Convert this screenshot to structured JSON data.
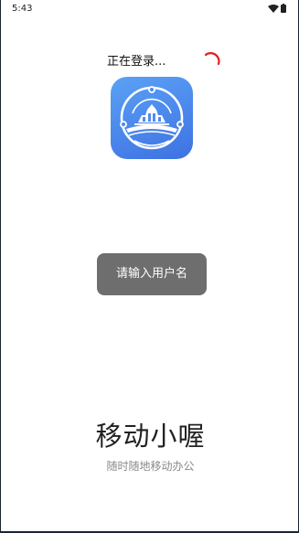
{
  "status_bar": {
    "time": "5:43",
    "wifi_icon": "wifi-icon",
    "battery_icon": "battery-icon"
  },
  "login": {
    "status_text": "正在登录..."
  },
  "logo": {
    "icon": "app-logo-icon",
    "colors": {
      "gradient_start": "#5aa2f4",
      "gradient_end": "#3d72e2"
    }
  },
  "toast": {
    "message": "请输入用户名"
  },
  "brand": {
    "name": "移动小喔",
    "slogan": "随时随地移动办公"
  },
  "colors": {
    "spinner": "#e02020",
    "toast_bg": "#6e6e6e",
    "slogan": "#8a8a8a"
  }
}
